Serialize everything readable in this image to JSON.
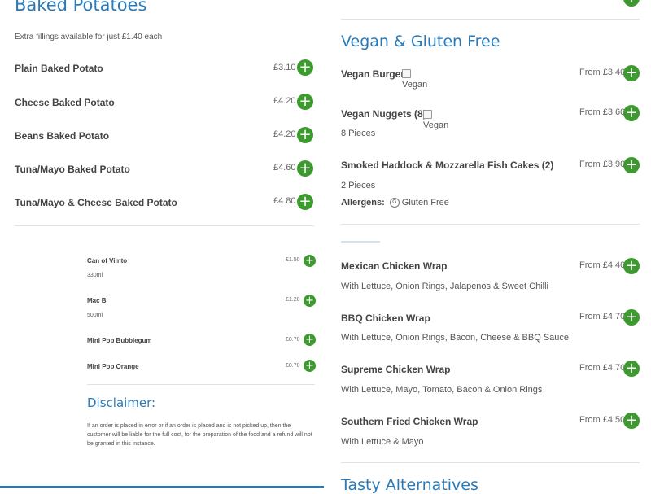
{
  "left": {
    "baked": {
      "title": "Baked Potatoes",
      "note": "Extra fillings available for just £1.40 each",
      "items": [
        {
          "name": "Plain Baked Potato",
          "price": "£3.10"
        },
        {
          "name": "Cheese Baked Potato",
          "price": "£4.20"
        },
        {
          "name": "Beans Baked Potato",
          "price": "£4.20"
        },
        {
          "name": "Tuna/Mayo Baked Potato",
          "price": "£4.60"
        },
        {
          "name": "Tuna/Mayo & Cheese Baked Potato",
          "price": "£4.80"
        }
      ]
    },
    "drinks": {
      "items": [
        {
          "name": "Can of Vimto",
          "price": "£1.50",
          "desc": "330ml"
        },
        {
          "name": "Mac B",
          "price": "£1.20",
          "desc": "500ml"
        },
        {
          "name": "Mini Pop Bubblegum",
          "price": "£0.70",
          "desc": ""
        },
        {
          "name": "Mini Pop Orange",
          "price": "£0.70",
          "desc": ""
        }
      ]
    },
    "disclaimer": {
      "title": "Disclaimer:",
      "text": "If an order is placed in error or if an order is placed and is not picked up, then the customer will be liable for the full cost, for the preparation of the food and a refund will not be granted in this instance."
    }
  },
  "right": {
    "vegan": {
      "title": "Vegan & Gluten Free",
      "items": [
        {
          "name": "Vegan Burger",
          "price": "From £3.40",
          "img_alt": "Vegan",
          "desc": ""
        },
        {
          "name": "Vegan Nuggets (8)",
          "price": "From £3.60",
          "img_alt": "Vegan",
          "desc": "8 Pieces"
        },
        {
          "name": "Smoked Haddock & Mozzarella Fish Cakes (2)",
          "price": "From £3.90",
          "desc": "2 Pieces",
          "allergens_label": "Allergens:",
          "allergen": "Gluten Free"
        }
      ]
    },
    "wraps": {
      "items": [
        {
          "name": "Mexican Chicken Wrap",
          "price": "From £4.40",
          "desc": "With Lettuce, Onion Rings, Jalapenos & Sweet Chilli"
        },
        {
          "name": "BBQ Chicken Wrap",
          "price": "From £4.70",
          "desc": "With Lettuce, Onion Rings, Bacon, Cheese & BBQ Sauce"
        },
        {
          "name": "Supreme Chicken Wrap",
          "price": "From £4.70",
          "desc": "With Lettuce, Mayo, Tomato, Bacon & Onion Rings"
        },
        {
          "name": "Southern Fried Chicken Wrap",
          "price": "From £4.50",
          "desc": "With Lettuce & Mayo"
        }
      ]
    },
    "next_title": "Tasty Alternatives"
  },
  "colors": {
    "accent": "#2a7ab8",
    "add_button": "#3c9a2e",
    "divider": "#e2e2e2"
  },
  "icons": {
    "add": "plus-circle-icon",
    "allergen": "gluten-free-icon",
    "broken_image": "broken-image-icon"
  }
}
